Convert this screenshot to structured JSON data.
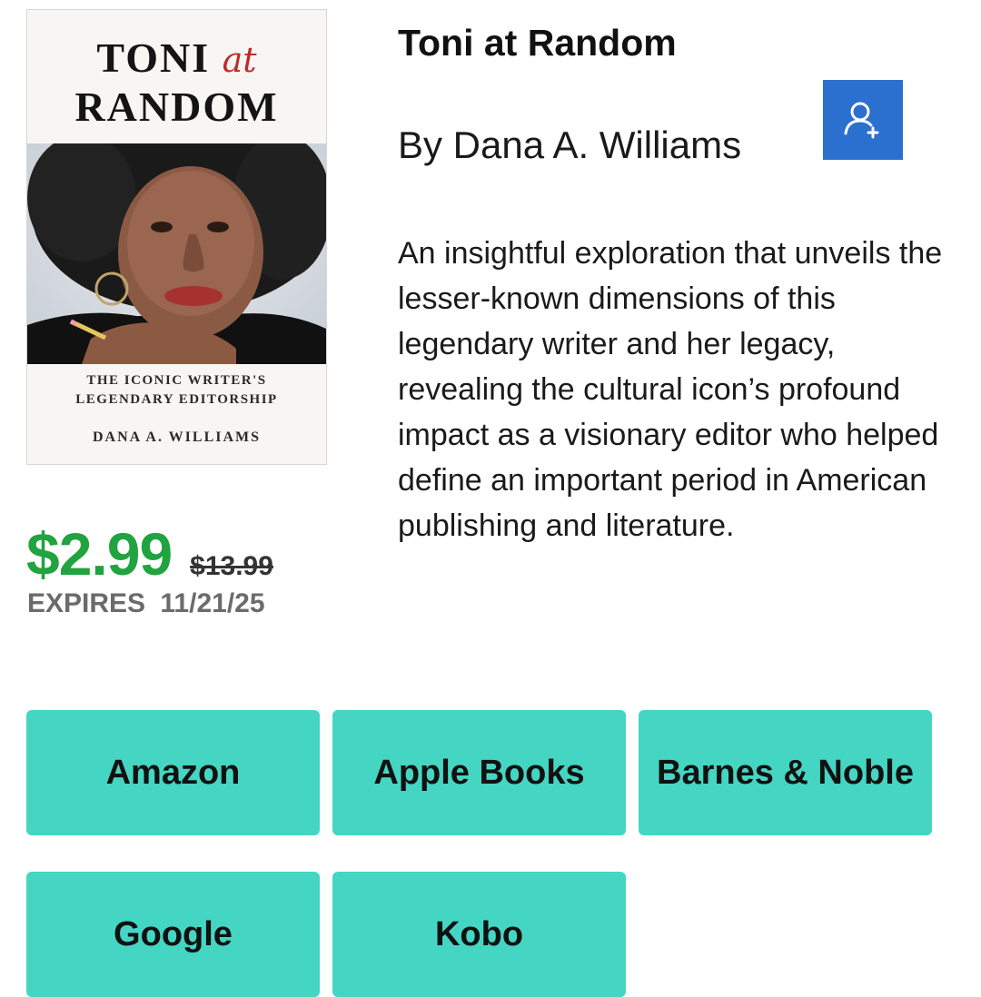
{
  "cover": {
    "title_line1": "TONI",
    "title_at": "at",
    "title_line2": "RANDOM",
    "subtitle_line1": "THE ICONIC WRITER'S",
    "subtitle_line2": "LEGENDARY EDITORSHIP",
    "author": "DANA A. WILLIAMS"
  },
  "book": {
    "title": "Toni at Random",
    "byline": "By Dana A. Williams",
    "description": "An insightful exploration that unveils the lesser-known dimensions of this legendary writer and her legacy, revealing the cultural icon’s profound impact as a visionary editor who helped define an important period in American publishing and literature."
  },
  "follow_button": {
    "icon": "add-user-icon",
    "color": "#2b6fcf"
  },
  "price": {
    "current": "$2.99",
    "original": "$13.99",
    "expires_label": "EXPIRES",
    "expires_date": "11/21/25",
    "current_color": "#21a33f"
  },
  "stores": {
    "color": "#44d6c3",
    "items": [
      {
        "label": "Amazon"
      },
      {
        "label": "Apple Books"
      },
      {
        "label": "Barnes & Noble"
      },
      {
        "label": "Google"
      },
      {
        "label": "Kobo"
      }
    ]
  }
}
